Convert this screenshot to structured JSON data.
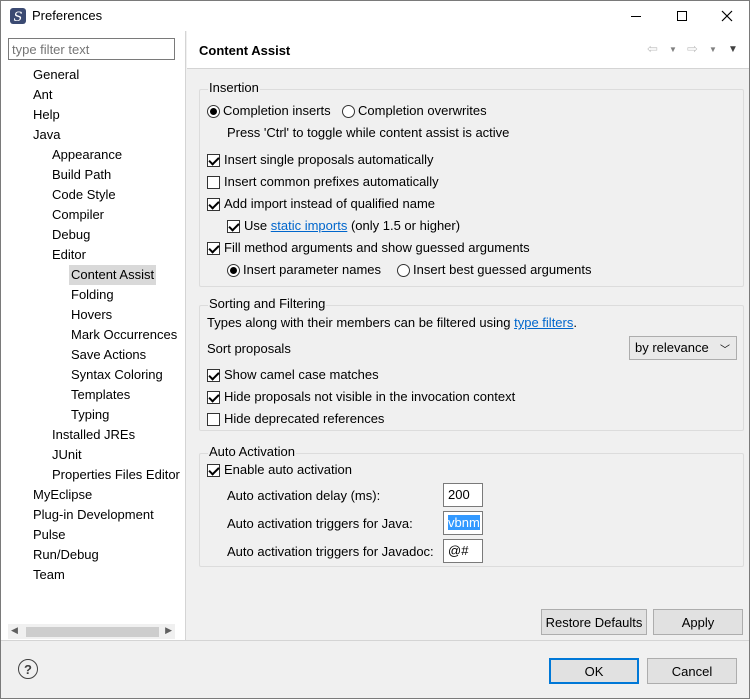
{
  "window": {
    "title": "Preferences"
  },
  "filter": {
    "placeholder": "type filter text"
  },
  "tree": [
    {
      "label": "General",
      "level": 0
    },
    {
      "label": "Ant",
      "level": 0
    },
    {
      "label": "Help",
      "level": 0
    },
    {
      "label": "Java",
      "level": 0
    },
    {
      "label": "Appearance",
      "level": 1
    },
    {
      "label": "Build Path",
      "level": 1
    },
    {
      "label": "Code Style",
      "level": 1
    },
    {
      "label": "Compiler",
      "level": 1
    },
    {
      "label": "Debug",
      "level": 1
    },
    {
      "label": "Editor",
      "level": 1
    },
    {
      "label": "Content Assist",
      "level": 2,
      "selected": true
    },
    {
      "label": "Folding",
      "level": 2
    },
    {
      "label": "Hovers",
      "level": 2
    },
    {
      "label": "Mark Occurrences",
      "level": 2
    },
    {
      "label": "Save Actions",
      "level": 2
    },
    {
      "label": "Syntax Coloring",
      "level": 2
    },
    {
      "label": "Templates",
      "level": 2
    },
    {
      "label": "Typing",
      "level": 2
    },
    {
      "label": "Installed JREs",
      "level": 1
    },
    {
      "label": "JUnit",
      "level": 1
    },
    {
      "label": "Properties Files Editor",
      "level": 1
    },
    {
      "label": "MyEclipse",
      "level": 0
    },
    {
      "label": "Plug-in Development",
      "level": 0
    },
    {
      "label": "Pulse",
      "level": 0
    },
    {
      "label": "Run/Debug",
      "level": 0
    },
    {
      "label": "Team",
      "level": 0
    }
  ],
  "page": {
    "title": "Content Assist"
  },
  "insertion": {
    "title": "Insertion",
    "completion_inserts": "Completion inserts",
    "completion_overwrites": "Completion overwrites",
    "hint": "Press 'Ctrl' to toggle while content assist is active",
    "single_proposals": "Insert single proposals automatically",
    "common_prefixes": "Insert common prefixes automatically",
    "add_import": "Add import instead of qualified name",
    "use_label": "Use",
    "static_imports_link": "static imports",
    "static_imports_suffix": "(only 1.5 or higher)",
    "fill_args": "Fill method arguments and show guessed arguments",
    "insert_param_names": "Insert parameter names",
    "insert_best_guessed": "Insert best guessed arguments"
  },
  "sorting": {
    "title": "Sorting and Filtering",
    "types_text": "Types along with their members can be filtered using",
    "type_filters_link": "type filters",
    "period": ".",
    "sort_label": "Sort proposals",
    "sort_value": "by relevance",
    "camel_case": "Show camel case matches",
    "hide_not_visible": "Hide proposals not visible in the invocation context",
    "hide_deprecated": "Hide deprecated references"
  },
  "auto_activation": {
    "title": "Auto Activation",
    "enable": "Enable auto activation",
    "delay_label": "Auto activation delay (ms):",
    "delay_value": "200",
    "java_label": "Auto activation triggers for Java:",
    "java_value": "vbnm",
    "javadoc_label": "Auto activation triggers for Javadoc:",
    "javadoc_value": "@#"
  },
  "buttons": {
    "restore_defaults": "Restore Defaults",
    "apply": "Apply",
    "ok": "OK",
    "cancel": "Cancel"
  },
  "help_icon_glyph": "?"
}
